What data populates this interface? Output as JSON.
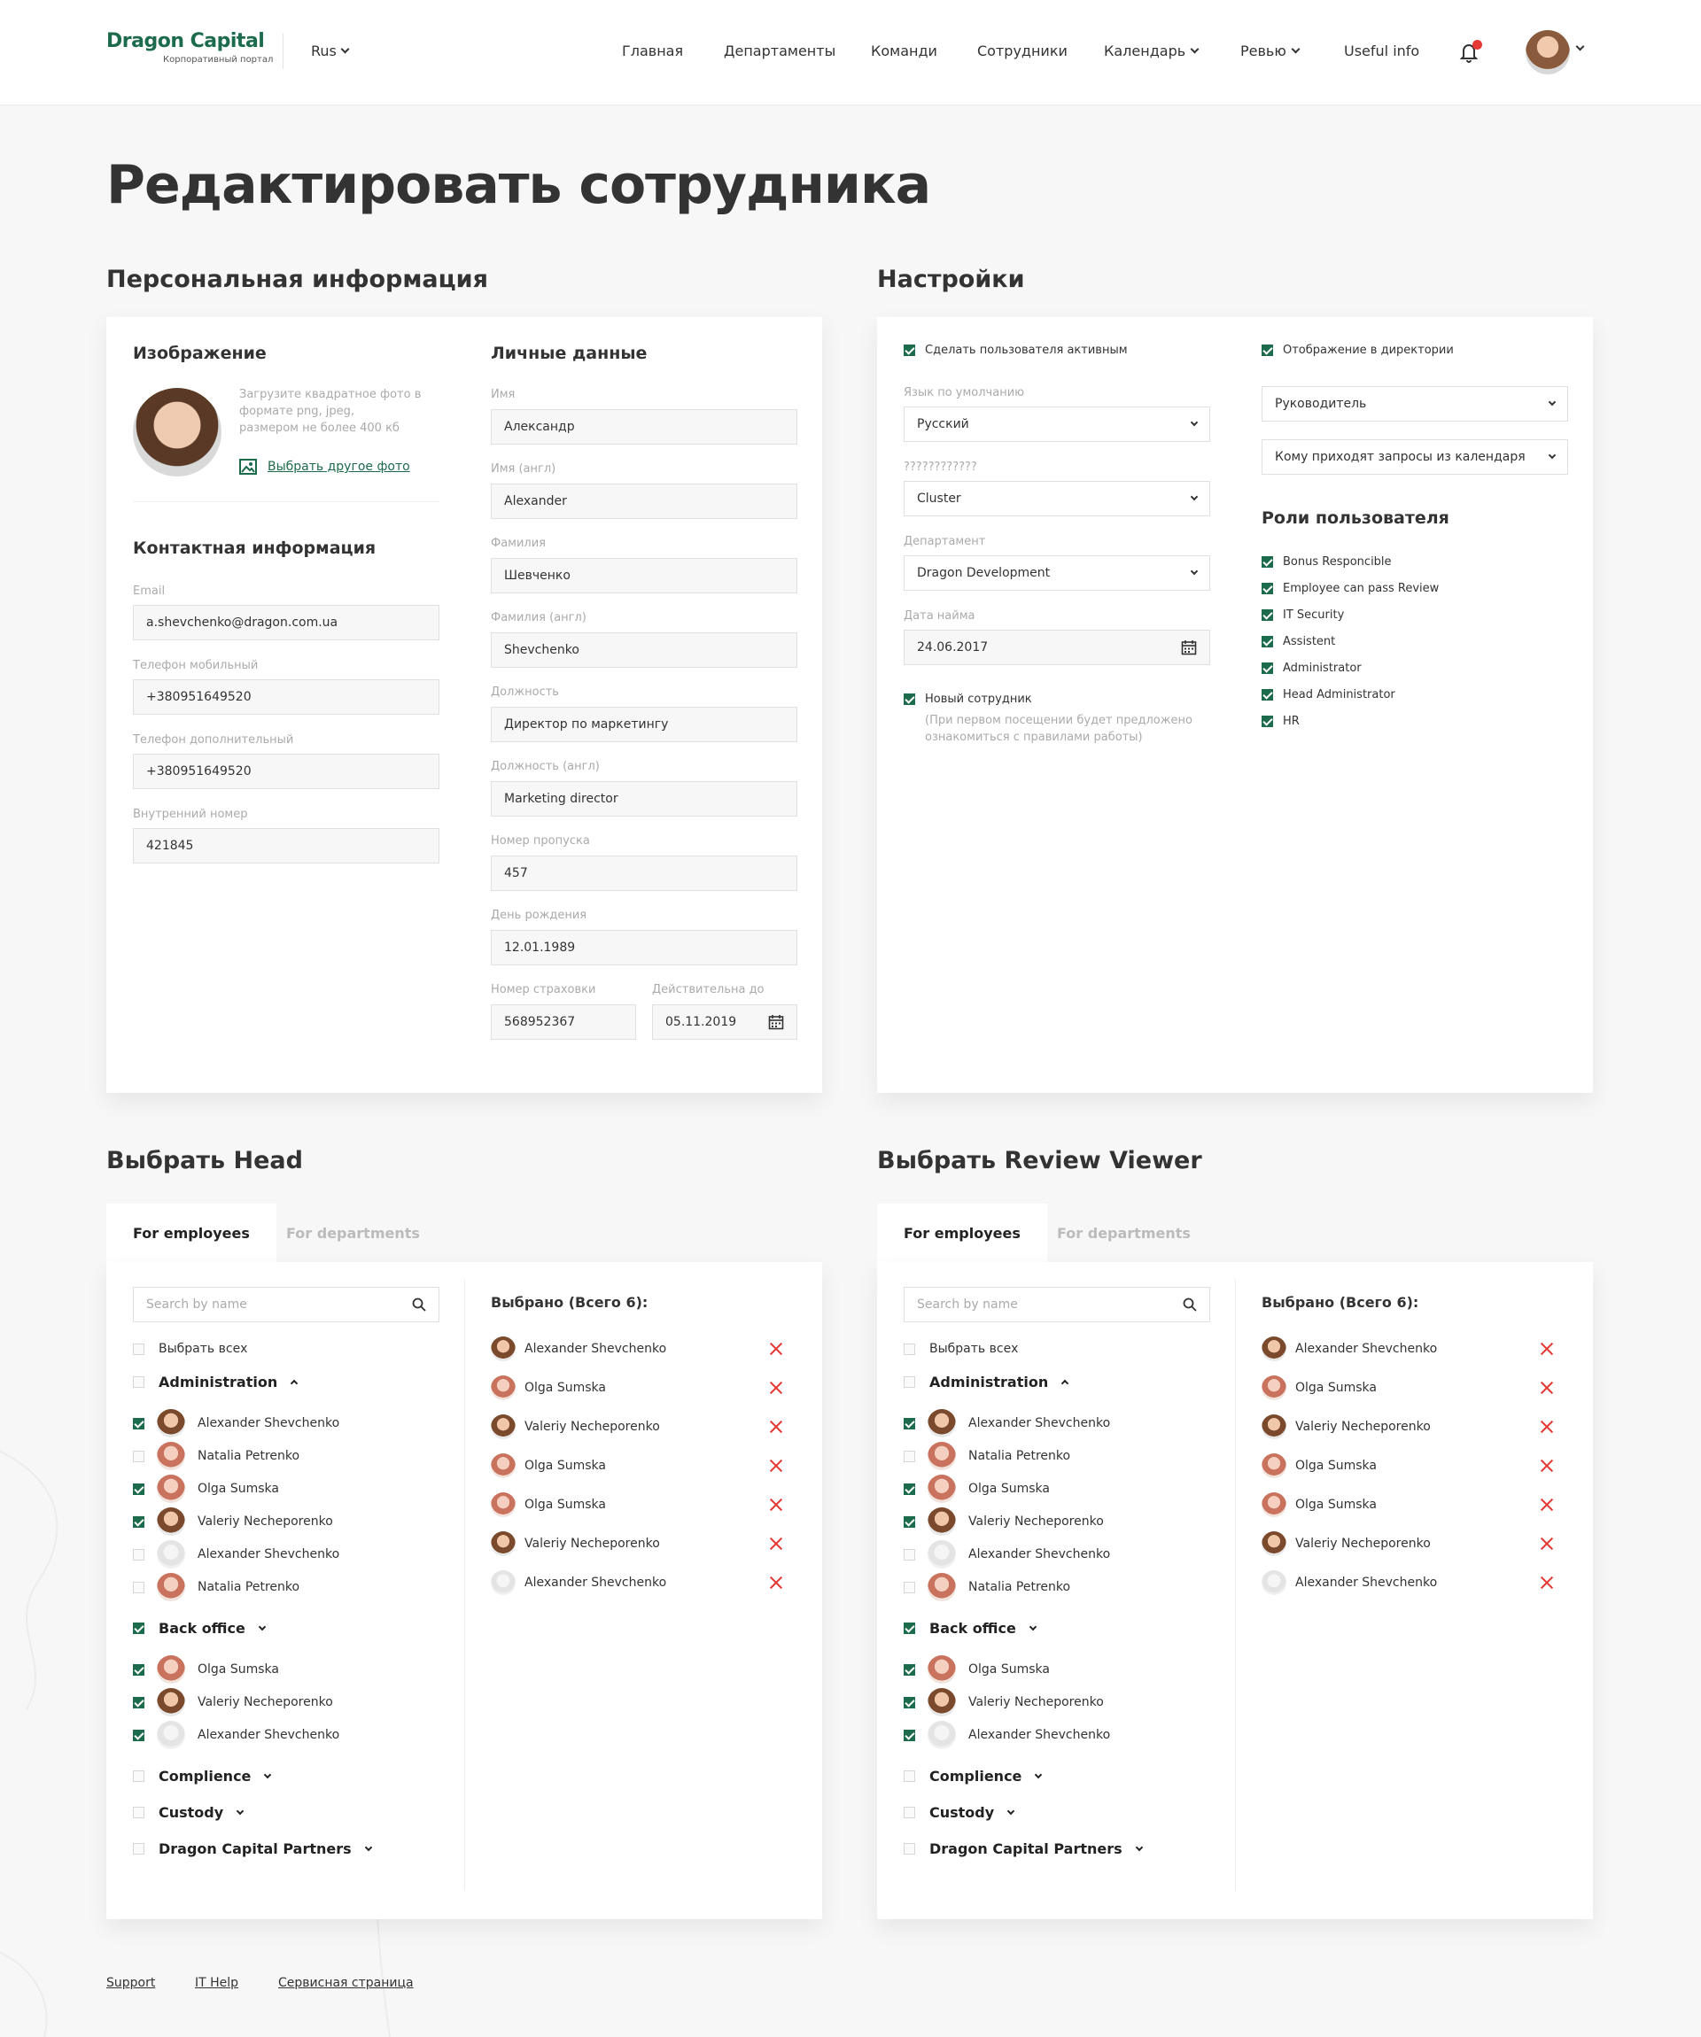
{
  "header": {
    "logo_name": "Dragon Capital",
    "logo_sub": "Корпоративный портал",
    "lang": "Rus",
    "nav": [
      "Главная",
      "Департаменты",
      "Команди",
      "Сотрудники",
      "Календарь",
      "Ревью",
      "Useful info"
    ]
  },
  "page": {
    "title": "Редактировать сотрудника"
  },
  "personal": {
    "section_title": "Персональная информация",
    "image_title": "Изображение",
    "upload_hint": [
      "Загрузите квадратное фото в",
      "формате png, jpeg,",
      "размером не более 400 кб"
    ],
    "choose_photo": "Выбрать другое фото",
    "contact_title": "Контактная информация",
    "contact_fields": [
      {
        "label": "Email",
        "value": "a.shevchenko@dragon.com.ua"
      },
      {
        "label": "Телефон мобильный",
        "value": "+380951649520"
      },
      {
        "label": "Телефон дополнительный",
        "value": "+380951649520"
      },
      {
        "label": "Внутренний номер",
        "value": "421845"
      }
    ],
    "personal_title": "Личные данные",
    "personal_fields": [
      {
        "label": "Имя",
        "value": "Александр"
      },
      {
        "label": "Имя (англ)",
        "value": "Alexander"
      },
      {
        "label": "Фамилия",
        "value": "Шевченко"
      },
      {
        "label": "Фамилия (англ)",
        "value": "Shevchenko"
      },
      {
        "label": "Должность",
        "value": "Директор по маркетингу"
      },
      {
        "label": "Должность (англ)",
        "value": "Marketing director"
      },
      {
        "label": "Номер пропуска",
        "value": "457"
      },
      {
        "label": "День рождения",
        "value": "12.01.1989"
      }
    ],
    "insurance": {
      "label": "Номер страховки",
      "value": "568952367"
    },
    "valid": {
      "label": "Действительна до",
      "value": "05.11.2019"
    }
  },
  "settings": {
    "section_title": "Настройки",
    "active_label": "Сделать пользователя активным",
    "lang_label": "Язык по умолчанию",
    "lang_value": "Русский",
    "unknown_label": "????????????",
    "unknown_value": "Cluster",
    "dept_label": "Департамент",
    "dept_value": "Dragon Development",
    "hire_label": "Дата найма",
    "hire_value": "24.06.2017",
    "new_label": "Новый сотрудник",
    "new_note": [
      "(При первом посещении будет предложено",
      "ознакомиться с правилами работы)"
    ],
    "directory_label": "Отображение в директории",
    "role_select": "Руководитель",
    "calendar_select": "Кому приходят запросы из календаря",
    "roles_title": "Роли пользователя",
    "roles": [
      "Bonus Responcible",
      "Employee can pass Review",
      "IT Security",
      "Assistent",
      "Administrator",
      "Head Administrator",
      "HR"
    ]
  },
  "picker": {
    "head_title": "Выбрать Head",
    "viewer_title": "Выбрать Review Viewer",
    "tab_employees": "For employees",
    "tab_departments": "For departments",
    "search_placeholder": "Search by name",
    "select_all": "Выбрать всех",
    "selected_title": "Выбрано (Всего 6):",
    "groups": [
      {
        "name": "Administration",
        "open": true,
        "checked": false,
        "members": [
          {
            "name": "Alexander Shevchenko",
            "checked": true,
            "av": "m"
          },
          {
            "name": "Natalia Petrenko",
            "checked": false,
            "av": "f"
          },
          {
            "name": "Olga Sumska",
            "checked": true,
            "av": "f"
          },
          {
            "name": "Valeriy Necheporenko",
            "checked": true,
            "av": "m"
          },
          {
            "name": "Alexander Shevchenko",
            "checked": false,
            "av": "d"
          },
          {
            "name": "Natalia Petrenko",
            "checked": false,
            "av": "f"
          }
        ]
      },
      {
        "name": "Back office",
        "open": false,
        "checked": true,
        "members": [
          {
            "name": "Olga Sumska",
            "checked": true,
            "av": "f"
          },
          {
            "name": "Valeriy Necheporenko",
            "checked": true,
            "av": "m"
          },
          {
            "name": "Alexander Shevchenko",
            "checked": true,
            "av": "d"
          }
        ]
      },
      {
        "name": "Complience",
        "open": false,
        "checked": false,
        "members": []
      },
      {
        "name": "Custody",
        "open": false,
        "checked": false,
        "members": []
      },
      {
        "name": "Dragon Capital Partners",
        "open": false,
        "checked": false,
        "members": []
      }
    ],
    "selected": [
      {
        "name": "Alexander Shevchenko",
        "av": "m"
      },
      {
        "name": "Olga Sumska",
        "av": "f"
      },
      {
        "name": "Valeriy Necheporenko",
        "av": "m"
      },
      {
        "name": "Olga Sumska",
        "av": "f"
      },
      {
        "name": "Olga Sumska",
        "av": "f"
      },
      {
        "name": "Valeriy Necheporenko",
        "av": "m"
      },
      {
        "name": "Alexander Shevchenko",
        "av": "d"
      }
    ]
  },
  "footer": {
    "links": [
      "Support",
      "IT Help",
      "Сервисная страница"
    ]
  },
  "colors": {
    "brand": "#1c6b4c",
    "danger": "#e53935",
    "bg": "#f7f7f7"
  }
}
